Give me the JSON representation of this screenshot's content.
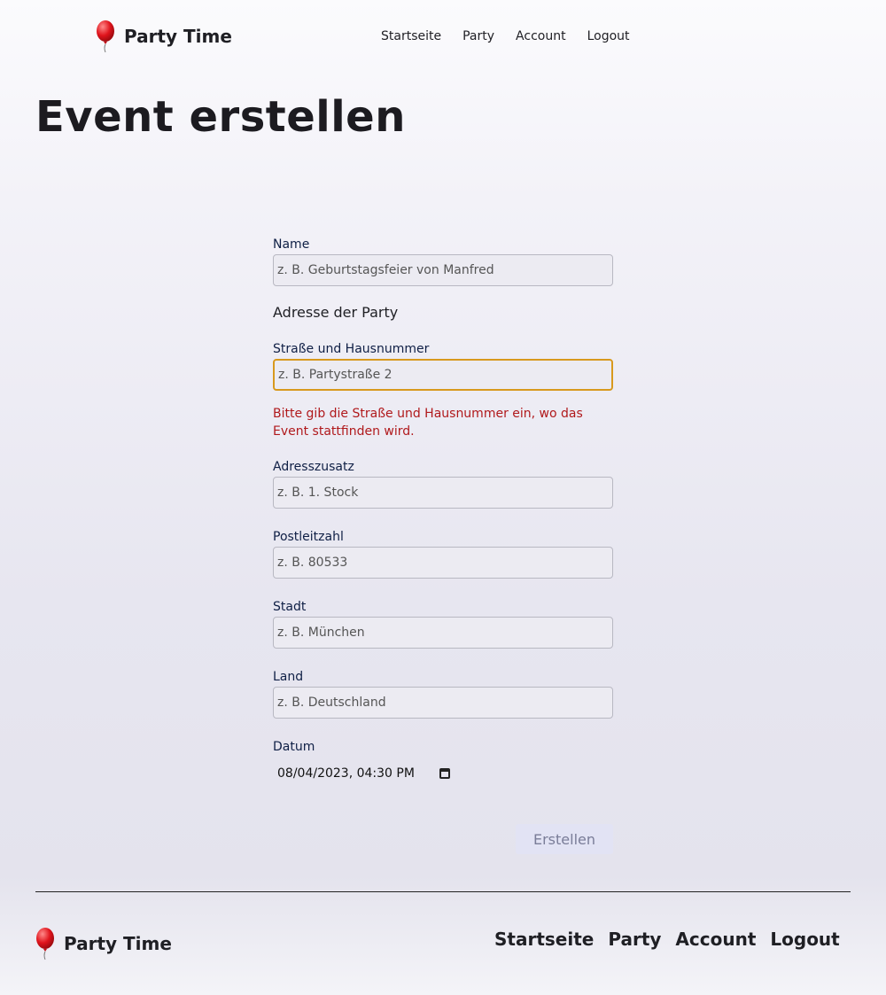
{
  "header": {
    "brand": "Party Time",
    "nav": [
      "Startseite",
      "Party",
      "Account",
      "Logout"
    ]
  },
  "page": {
    "title": "Event erstellen"
  },
  "form": {
    "name": {
      "label": "Name",
      "placeholder": "z. B. Geburtstagsfeier von Manfred",
      "value": ""
    },
    "address_heading": "Adresse der Party",
    "street": {
      "label": "Straße und Hausnummer",
      "placeholder": "z. B. Partystraße 2",
      "value": "",
      "error": "Bitte gib die Straße und Hausnummer ein, wo das Event stattfinden wird."
    },
    "addition": {
      "label": "Adresszusatz",
      "placeholder": "z. B. 1. Stock",
      "value": ""
    },
    "zip": {
      "label": "Postleitzahl",
      "placeholder": "z. B. 80533",
      "value": ""
    },
    "city": {
      "label": "Stadt",
      "placeholder": "z. B. München",
      "value": ""
    },
    "country": {
      "label": "Land",
      "placeholder": "z. B. Deutschland",
      "value": ""
    },
    "date": {
      "label": "Datum",
      "value": "08/04/2023, 04:30 PM"
    },
    "submit_label": "Erstellen"
  },
  "footer": {
    "brand": "Party Time",
    "nav": [
      "Startseite",
      "Party",
      "Account",
      "Logout"
    ]
  },
  "icons": {
    "brand": "red-balloon-icon",
    "date_picker": "calendar-icon"
  },
  "colors": {
    "accent_focus": "#d8991d",
    "error": "#b0191c",
    "label": "#0f1f45"
  }
}
